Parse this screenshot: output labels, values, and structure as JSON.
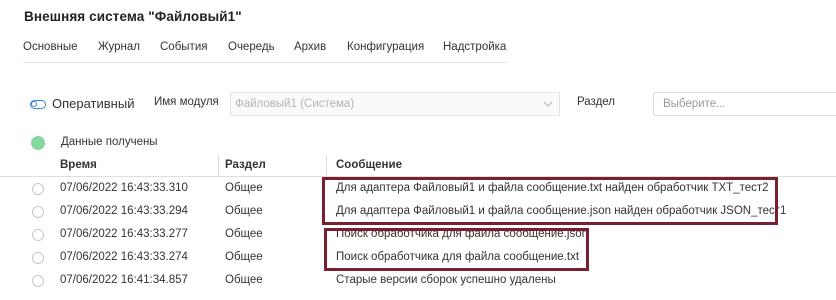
{
  "window": {
    "title": "Внешняя система \"Файловый1\""
  },
  "tabs": [
    {
      "label": "Основные"
    },
    {
      "label": "Журнал"
    },
    {
      "label": "События"
    },
    {
      "label": "Очередь"
    },
    {
      "label": "Архив"
    },
    {
      "label": "Конфигурация"
    },
    {
      "label": "Надстройка"
    }
  ],
  "toolbar": {
    "toggle_label": "Оперативный",
    "module_label": "Имя модуля",
    "module_value": "Файловый1 (Система)",
    "section_label": "Раздел",
    "section_placeholder": "Выберите..."
  },
  "status": {
    "text": "Данные получены",
    "color": "#86d8a0"
  },
  "grid": {
    "columns": [
      "Время",
      "Раздел",
      "Сообщение"
    ],
    "rows": [
      {
        "time": "07/06/2022 16:43:33.310",
        "section": "Общее",
        "message": "Для адаптера Файловый1 и файла сообщение.txt найден обработчик TXT_тест2"
      },
      {
        "time": "07/06/2022 16:43:33.294",
        "section": "Общее",
        "message": "Для адаптера Файловый1 и файла сообщение.json найден обработчик JSON_тест1"
      },
      {
        "time": "07/06/2022 16:43:33.277",
        "section": "Общее",
        "message": "Поиск обработчика для файла сообщение.json"
      },
      {
        "time": "07/06/2022 16:43:33.274",
        "section": "Общее",
        "message": "Поиск обработчика для файла сообщение.txt"
      },
      {
        "time": "07/06/2022 16:41:34.857",
        "section": "Общее",
        "message": "Старые версии сборок успешно удалены"
      }
    ]
  },
  "colors": {
    "accent": "#3a86d4",
    "highlight": "#7a1f30"
  }
}
